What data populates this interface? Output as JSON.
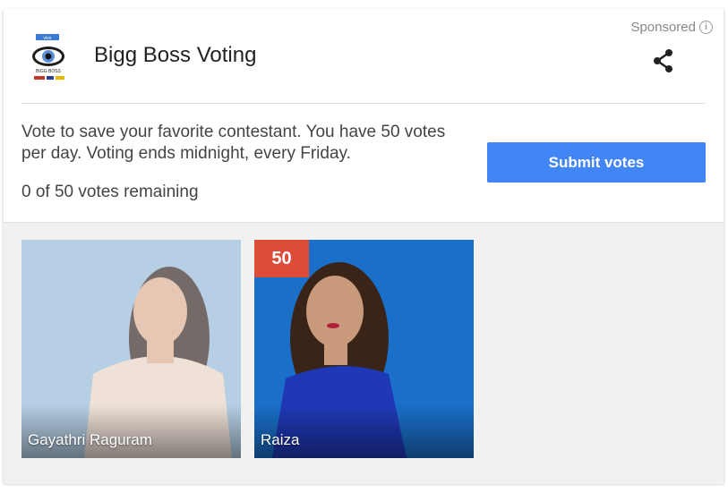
{
  "header": {
    "title": "Bigg Boss Voting",
    "sponsored_label": "Sponsored",
    "logo_lines": [
      "vivo",
      "BIGG BOSS"
    ]
  },
  "body": {
    "description": "Vote to save your favorite contestant. You have 50 votes per day. Voting ends midnight, every Friday.",
    "remaining": "0 of 50 votes remaining",
    "submit_label": "Submit votes"
  },
  "contestants": [
    {
      "name": "Gayathri Raguram",
      "votes": "",
      "selected": false
    },
    {
      "name": "Raiza",
      "votes": "50",
      "selected": true
    }
  ],
  "colors": {
    "accent": "#4285f4",
    "badge": "#dd4b39"
  },
  "icons": [
    "info-icon",
    "share-icon",
    "bigg-boss-eye-logo"
  ]
}
